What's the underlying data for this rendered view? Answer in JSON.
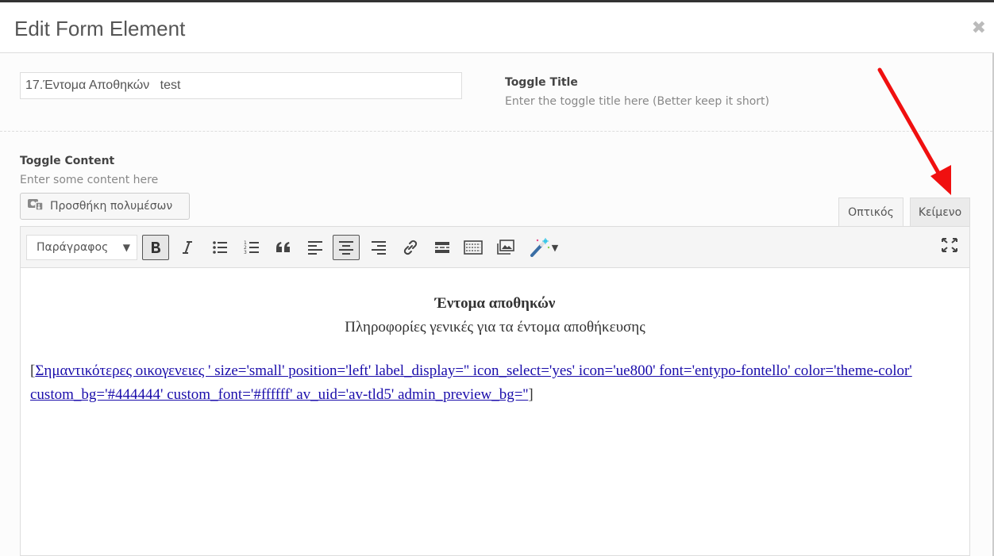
{
  "modal": {
    "title": "Edit Form Element"
  },
  "toggle_title": {
    "value": "17.Έντομα Αποθηκών   test",
    "label": "Toggle Title",
    "description": "Enter the toggle title here (Better keep it short)"
  },
  "toggle_content": {
    "label": "Toggle Content",
    "description": "Enter some content here",
    "media_button": "Προσθήκη πολυμέσων",
    "tabs": {
      "visual": "Οπτικός",
      "text": "Κείμενο"
    },
    "toolbar": {
      "format_value": "Παράγραφος"
    },
    "body": {
      "heading": "Έντομα αποθηκών",
      "subheading": "Πληροφορίες γενικές για τα έντομα αποθήκευσης",
      "shortcode_open": "[",
      "shortcode_link": "Σημαντικότερες οικογενειες ' size='small' position='left' label_display='' icon_select='yes' icon='ue800' font='entypo-fontello' color='theme-color' custom_bg='#444444' custom_font='#ffffff' av_uid='av-tld5' admin_preview_bg=''",
      "shortcode_close": "]"
    }
  },
  "colors": {
    "arrow": "#f01010",
    "link": "#1a0dab"
  }
}
